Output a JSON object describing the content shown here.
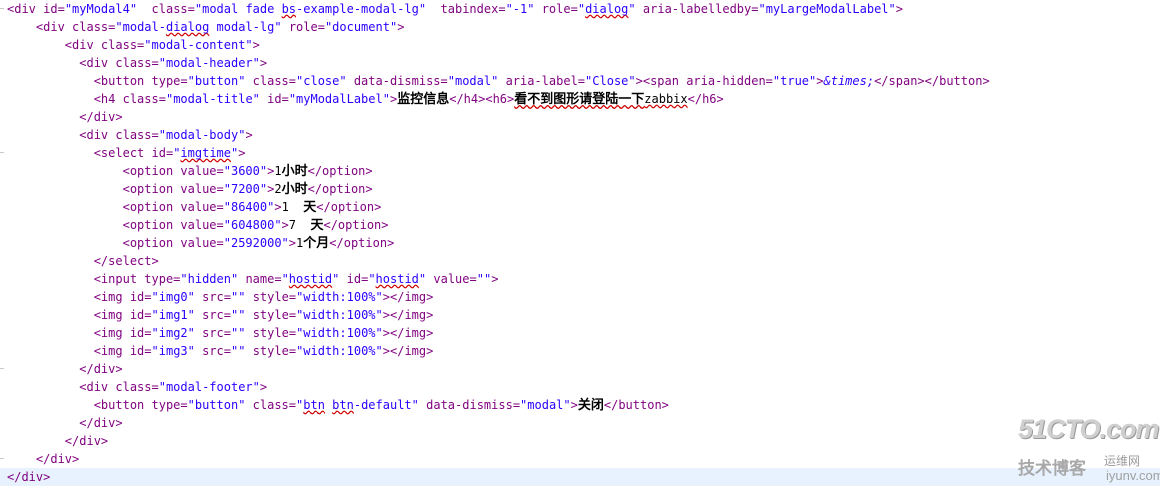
{
  "editor": {
    "lines": [
      {
        "indent": "",
        "tokens": [
          [
            "t",
            "<div "
          ],
          [
            "a",
            "id="
          ],
          [
            "v",
            "\"myModal4\""
          ],
          [
            "x",
            "  "
          ],
          [
            "a",
            "class="
          ],
          [
            "v",
            "\"modal fade "
          ],
          [
            "vsq",
            "bs"
          ],
          [
            "v",
            "-example-modal-lg\""
          ],
          [
            "x",
            "  "
          ],
          [
            "a",
            "tabindex="
          ],
          [
            "v",
            "\"-1\""
          ],
          [
            "x",
            " "
          ],
          [
            "a",
            "role="
          ],
          [
            "v",
            "\""
          ],
          [
            "vsq",
            "dialog"
          ],
          [
            "v",
            "\""
          ],
          [
            "x",
            " "
          ],
          [
            "a",
            "aria-labelledby="
          ],
          [
            "v",
            "\"myLargeModalLabel\""
          ],
          [
            "t",
            ">"
          ]
        ]
      },
      {
        "indent": "    ",
        "tokens": [
          [
            "t",
            "<div "
          ],
          [
            "a",
            "class="
          ],
          [
            "v",
            "\"modal-"
          ],
          [
            "vsq",
            "dialog"
          ],
          [
            "v",
            " modal-lg\""
          ],
          [
            "x",
            " "
          ],
          [
            "a",
            "role="
          ],
          [
            "v",
            "\"document\""
          ],
          [
            "t",
            ">"
          ]
        ]
      },
      {
        "indent": "        ",
        "tokens": [
          [
            "t",
            "<div "
          ],
          [
            "a",
            "class="
          ],
          [
            "v",
            "\"modal-content\""
          ],
          [
            "t",
            ">"
          ]
        ]
      },
      {
        "indent": "          ",
        "tokens": [
          [
            "t",
            "<div "
          ],
          [
            "a",
            "class="
          ],
          [
            "v",
            "\"modal-header\""
          ],
          [
            "t",
            ">"
          ]
        ]
      },
      {
        "indent": "            ",
        "tokens": [
          [
            "t",
            "<button "
          ],
          [
            "a",
            "type="
          ],
          [
            "v",
            "\"button\""
          ],
          [
            "x",
            " "
          ],
          [
            "a",
            "class="
          ],
          [
            "v",
            "\"close\""
          ],
          [
            "x",
            " "
          ],
          [
            "a",
            "data-dismiss="
          ],
          [
            "v",
            "\"modal\""
          ],
          [
            "x",
            " "
          ],
          [
            "a",
            "aria-label="
          ],
          [
            "v",
            "\"Close\""
          ],
          [
            "t",
            "><span "
          ],
          [
            "a",
            "aria-hidden="
          ],
          [
            "v",
            "\"true\""
          ],
          [
            "t",
            ">"
          ],
          [
            "e",
            "&times;"
          ],
          [
            "t",
            "</span></button>"
          ]
        ]
      },
      {
        "indent": "            ",
        "tokens": [
          [
            "t",
            "<h4 "
          ],
          [
            "a",
            "class="
          ],
          [
            "v",
            "\"modal-title\""
          ],
          [
            "x",
            " "
          ],
          [
            "a",
            "id="
          ],
          [
            "v",
            "\"myModalLabel\""
          ],
          [
            "t",
            ">"
          ],
          [
            "cn",
            "监控信息"
          ],
          [
            "t",
            "</h4><h6>"
          ],
          [
            "cnsq",
            "看不到图形请登陆一下"
          ],
          [
            "xsq",
            "zabbix"
          ],
          [
            "t",
            "</h6>"
          ]
        ]
      },
      {
        "indent": "          ",
        "tokens": [
          [
            "t",
            "</div>"
          ]
        ]
      },
      {
        "indent": "          ",
        "tokens": [
          [
            "t",
            "<div "
          ],
          [
            "a",
            "class="
          ],
          [
            "v",
            "\"modal-body\""
          ],
          [
            "t",
            ">"
          ]
        ]
      },
      {
        "indent": "            ",
        "tokens": [
          [
            "t",
            "<select "
          ],
          [
            "a",
            "id="
          ],
          [
            "v",
            "\""
          ],
          [
            "vsq",
            "imgtime"
          ],
          [
            "v",
            "\""
          ],
          [
            "t",
            ">"
          ]
        ]
      },
      {
        "indent": "                ",
        "tokens": [
          [
            "t",
            "<option "
          ],
          [
            "a",
            "value="
          ],
          [
            "v",
            "\"3600\""
          ],
          [
            "t",
            ">"
          ],
          [
            "x",
            "1"
          ],
          [
            "cn",
            "小时"
          ],
          [
            "t",
            "</option>"
          ]
        ]
      },
      {
        "indent": "                ",
        "tokens": [
          [
            "t",
            "<option "
          ],
          [
            "a",
            "value="
          ],
          [
            "v",
            "\"7200\""
          ],
          [
            "t",
            ">"
          ],
          [
            "x",
            "2"
          ],
          [
            "cn",
            "小时"
          ],
          [
            "t",
            "</option>"
          ]
        ]
      },
      {
        "indent": "                ",
        "tokens": [
          [
            "t",
            "<option "
          ],
          [
            "a",
            "value="
          ],
          [
            "v",
            "\"86400\""
          ],
          [
            "t",
            ">"
          ],
          [
            "x",
            "1  "
          ],
          [
            "cn",
            "天"
          ],
          [
            "t",
            "</option>"
          ]
        ]
      },
      {
        "indent": "                ",
        "tokens": [
          [
            "t",
            "<option "
          ],
          [
            "a",
            "value="
          ],
          [
            "v",
            "\"604800\""
          ],
          [
            "t",
            ">"
          ],
          [
            "x",
            "7  "
          ],
          [
            "cn",
            "天"
          ],
          [
            "t",
            "</option>"
          ]
        ]
      },
      {
        "indent": "                ",
        "tokens": [
          [
            "t",
            "<option "
          ],
          [
            "a",
            "value="
          ],
          [
            "v",
            "\"2592000\""
          ],
          [
            "t",
            ">"
          ],
          [
            "x",
            "1"
          ],
          [
            "cn",
            "个月"
          ],
          [
            "t",
            "</option>"
          ]
        ]
      },
      {
        "indent": "            ",
        "tokens": [
          [
            "t",
            "</select>"
          ]
        ]
      },
      {
        "indent": "            ",
        "tokens": [
          [
            "t",
            "<input "
          ],
          [
            "a",
            "type="
          ],
          [
            "v",
            "\"hidden\""
          ],
          [
            "x",
            " "
          ],
          [
            "a",
            "name="
          ],
          [
            "v",
            "\""
          ],
          [
            "vsq",
            "hostid"
          ],
          [
            "v",
            "\""
          ],
          [
            "x",
            " "
          ],
          [
            "a",
            "id="
          ],
          [
            "v",
            "\""
          ],
          [
            "vsq",
            "hostid"
          ],
          [
            "v",
            "\""
          ],
          [
            "x",
            " "
          ],
          [
            "a",
            "value="
          ],
          [
            "v",
            "\"\""
          ],
          [
            "t",
            ">"
          ]
        ]
      },
      {
        "indent": "            ",
        "tokens": [
          [
            "t",
            "<img "
          ],
          [
            "a",
            "id="
          ],
          [
            "v",
            "\"img0\""
          ],
          [
            "x",
            " "
          ],
          [
            "a",
            "src="
          ],
          [
            "v",
            "\"\""
          ],
          [
            "x",
            " "
          ],
          [
            "a",
            "style="
          ],
          [
            "v",
            "\"width:100%\""
          ],
          [
            "t",
            "></img>"
          ]
        ]
      },
      {
        "indent": "            ",
        "tokens": [
          [
            "t",
            "<img "
          ],
          [
            "a",
            "id="
          ],
          [
            "v",
            "\"img1\""
          ],
          [
            "x",
            " "
          ],
          [
            "a",
            "src="
          ],
          [
            "v",
            "\"\""
          ],
          [
            "x",
            " "
          ],
          [
            "a",
            "style="
          ],
          [
            "v",
            "\"width:100%\""
          ],
          [
            "t",
            "></img>"
          ]
        ]
      },
      {
        "indent": "            ",
        "tokens": [
          [
            "t",
            "<img "
          ],
          [
            "a",
            "id="
          ],
          [
            "v",
            "\"img2\""
          ],
          [
            "x",
            " "
          ],
          [
            "a",
            "src="
          ],
          [
            "v",
            "\"\""
          ],
          [
            "x",
            " "
          ],
          [
            "a",
            "style="
          ],
          [
            "v",
            "\"width:100%\""
          ],
          [
            "t",
            "></img>"
          ]
        ]
      },
      {
        "indent": "            ",
        "tokens": [
          [
            "t",
            "<img "
          ],
          [
            "a",
            "id="
          ],
          [
            "v",
            "\"img3\""
          ],
          [
            "x",
            " "
          ],
          [
            "a",
            "src="
          ],
          [
            "v",
            "\"\""
          ],
          [
            "x",
            " "
          ],
          [
            "a",
            "style="
          ],
          [
            "v",
            "\"width:100%\""
          ],
          [
            "t",
            "></img>"
          ]
        ]
      },
      {
        "indent": "          ",
        "tokens": [
          [
            "t",
            "</div>"
          ]
        ]
      },
      {
        "indent": "          ",
        "tokens": [
          [
            "t",
            "<div "
          ],
          [
            "a",
            "class="
          ],
          [
            "v",
            "\"modal-footer\""
          ],
          [
            "t",
            ">"
          ]
        ]
      },
      {
        "indent": "            ",
        "tokens": [
          [
            "t",
            "<button "
          ],
          [
            "a",
            "type="
          ],
          [
            "v",
            "\"button\""
          ],
          [
            "x",
            " "
          ],
          [
            "a",
            "class="
          ],
          [
            "v",
            "\""
          ],
          [
            "vsq",
            "btn"
          ],
          [
            "v",
            " "
          ],
          [
            "vsq",
            "btn"
          ],
          [
            "v",
            "-default\""
          ],
          [
            "x",
            " "
          ],
          [
            "a",
            "data-dismiss="
          ],
          [
            "v",
            "\"modal\""
          ],
          [
            "t",
            ">"
          ],
          [
            "cn",
            "关闭"
          ],
          [
            "t",
            "</button>"
          ]
        ]
      },
      {
        "indent": "          ",
        "tokens": [
          [
            "t",
            "</div>"
          ]
        ]
      },
      {
        "indent": "        ",
        "tokens": [
          [
            "t",
            "</div>"
          ]
        ]
      },
      {
        "indent": "    ",
        "tokens": [
          [
            "t",
            "</div>"
          ]
        ]
      },
      {
        "indent": "",
        "tokens": [
          [
            "t",
            "</div>"
          ]
        ],
        "highlight": true
      }
    ]
  },
  "watermark": {
    "main": "51CTO.com",
    "sub_left": "技术博客",
    "sub_right_top": "运维网",
    "sub_right_bottom": "iyunv.com"
  },
  "colors": {
    "tag": "#7f007f",
    "attribute": "#7f007f",
    "value": "#2a00ff",
    "text": "#000000",
    "current_line": "#e8f2fe",
    "squiggle": "#d00000"
  }
}
